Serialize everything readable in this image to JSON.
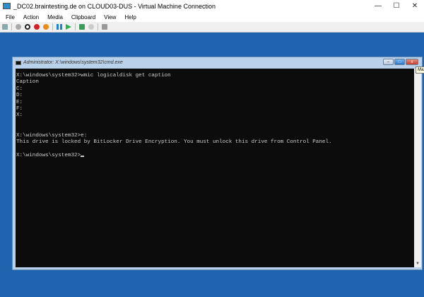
{
  "window": {
    "title": "_DC02.braintesting.de on CLOUD03-DUS - Virtual Machine Connection",
    "minimize": "—",
    "maximize": "☐",
    "close": "✕"
  },
  "menu": [
    "File",
    "Action",
    "Media",
    "Clipboard",
    "View",
    "Help"
  ],
  "toolbar": [
    "ctrl-alt-del",
    "start",
    "turn-off",
    "shut-down",
    "save",
    "pause",
    "resume",
    "checkpoint",
    "revert",
    "enhanced-session"
  ],
  "cmd": {
    "title": "Administrator: X:\\windows\\system32\\cmd.exe",
    "tooltip": "Maximize",
    "lines": [
      "X:\\windows\\system32>wmic logicaldisk get caption",
      "Caption",
      "C:",
      "D:",
      "E:",
      "F:",
      "X:",
      "",
      "",
      "X:\\windows\\system32>e:",
      "This drive is locked by BitLocker Drive Encryption. You must unlock this drive from Control Panel.",
      "",
      "X:\\windows\\system32>"
    ]
  }
}
